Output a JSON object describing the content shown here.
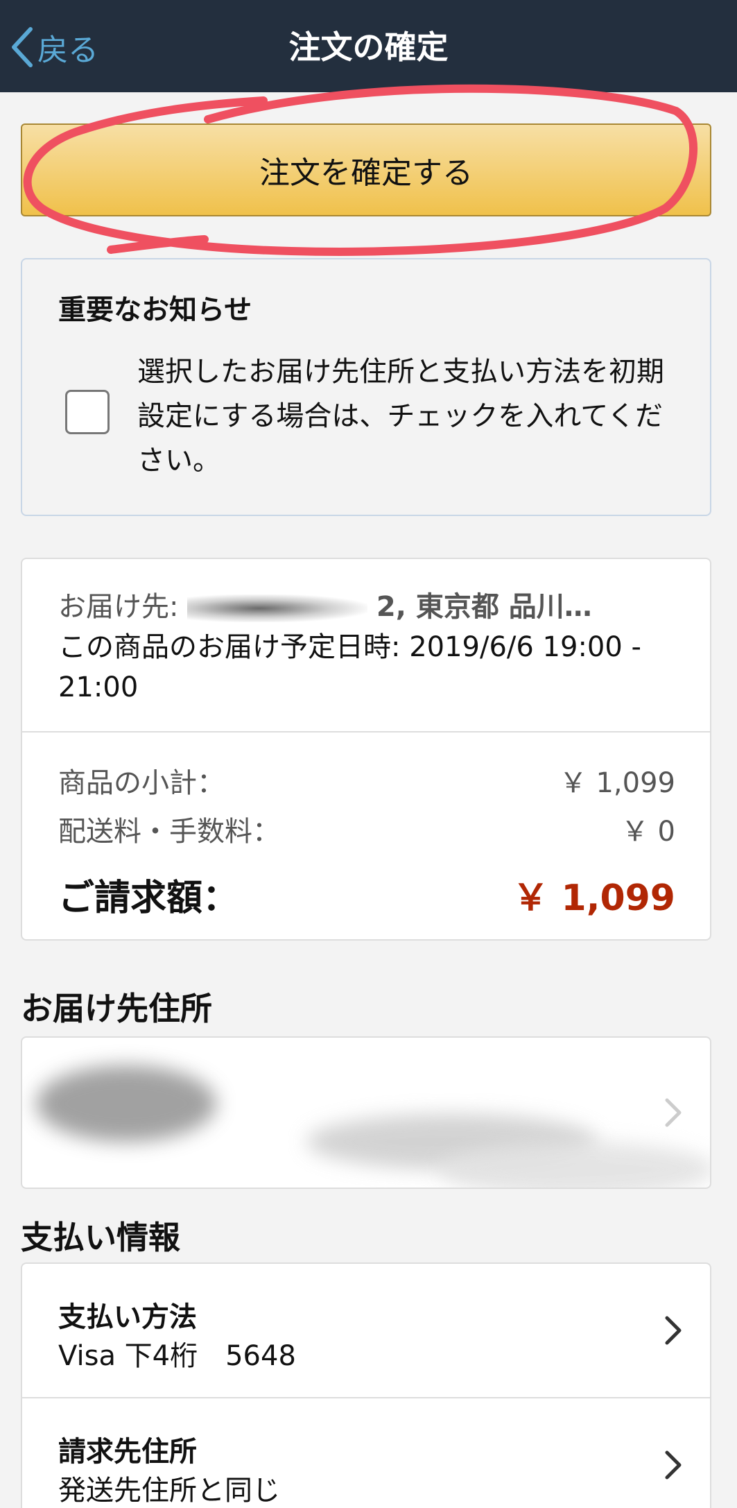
{
  "nav": {
    "back_label": "戻る",
    "title": "注文の確定"
  },
  "place_order": {
    "label": "注文を確定する"
  },
  "notice": {
    "title": "重要なお知らせ",
    "checkbox_checked": false,
    "text": "選択したお届け先住所と支払い方法を初期設定にする場合は、チェックを入れてください。"
  },
  "summary": {
    "ship_to_prefix": "お届け先:",
    "ship_to_suffix": "2, 東京都 品川…",
    "delivery_line": "この商品のお届け予定日時: 2019/6/6 19:00 - 21:00",
    "subtotal_label": "商品の小計：",
    "subtotal_value": "￥ 1,099",
    "shipping_label": "配送料・手数料：",
    "shipping_value": "￥ 0",
    "total_label": "ご請求額：",
    "total_value": "￥ 1,099"
  },
  "address_section": {
    "heading": "お届け先住所"
  },
  "payment_section": {
    "heading": "支払い情報",
    "method_label": "支払い方法",
    "method_value": "Visa 下4桁　5648",
    "billing_label": "請求先住所",
    "billing_value": "発送先住所と同じ"
  },
  "colors": {
    "nav_bg": "#232f3e",
    "back_link": "#5aa9d6",
    "button_yellow": "#f0c14b",
    "price_red": "#b12704",
    "annotation_red": "#ef5060"
  }
}
